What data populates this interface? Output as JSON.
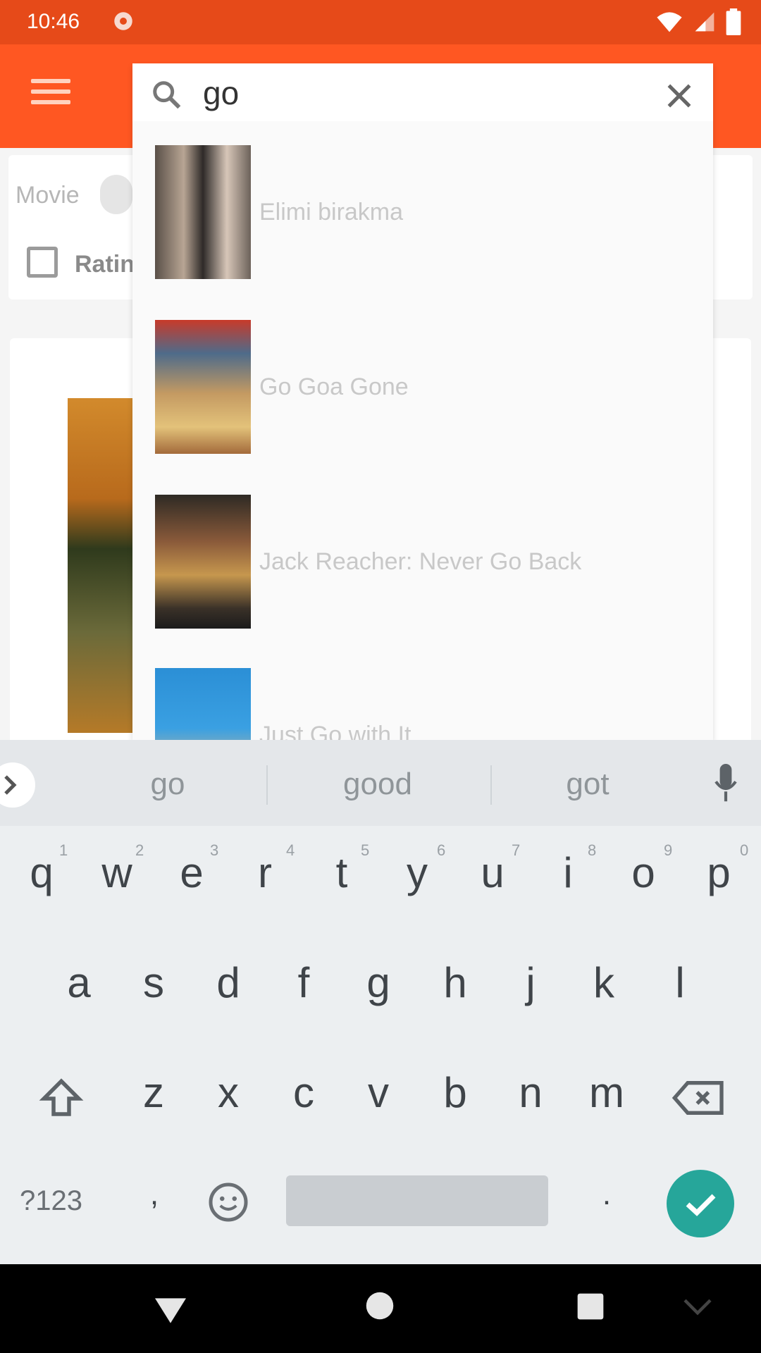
{
  "status_bar": {
    "time": "10:46"
  },
  "background": {
    "filter": {
      "movie_label": "Movie",
      "rating_label": "Ratin"
    }
  },
  "search": {
    "query": "go",
    "results": [
      {
        "title": "Elimi birakma"
      },
      {
        "title": "Go Goa Gone"
      },
      {
        "title": "Jack Reacher: Never Go Back"
      },
      {
        "title": "Just Go with It"
      }
    ]
  },
  "keyboard": {
    "suggestions": [
      "go",
      "good",
      "got"
    ],
    "row1": [
      {
        "k": "q",
        "h": "1"
      },
      {
        "k": "w",
        "h": "2"
      },
      {
        "k": "e",
        "h": "3"
      },
      {
        "k": "r",
        "h": "4"
      },
      {
        "k": "t",
        "h": "5"
      },
      {
        "k": "y",
        "h": "6"
      },
      {
        "k": "u",
        "h": "7"
      },
      {
        "k": "i",
        "h": "8"
      },
      {
        "k": "o",
        "h": "9"
      },
      {
        "k": "p",
        "h": "0"
      }
    ],
    "row2": [
      "a",
      "s",
      "d",
      "f",
      "g",
      "h",
      "j",
      "k",
      "l"
    ],
    "row3": [
      "z",
      "x",
      "c",
      "v",
      "b",
      "n",
      "m"
    ],
    "symbols_label": "?123",
    "comma": ",",
    "period": "."
  },
  "icons": {
    "status": [
      "settings-icon",
      "wifi-icon",
      "signal-icon",
      "battery-icon"
    ],
    "toolbar": [
      "menu-icon",
      "search-icon",
      "close-icon"
    ],
    "keyboard": [
      "chevron-right-icon",
      "mic-icon",
      "shift-icon",
      "backspace-icon",
      "emoji-icon",
      "check-icon"
    ],
    "nav": [
      "back-icon",
      "home-icon",
      "recents-icon",
      "keyboard-hide-icon"
    ]
  },
  "colors": {
    "status_bar": "#e64a19",
    "toolbar": "#ff5722",
    "keyboard_bg": "#eceff1",
    "enter_key": "#26a69a"
  }
}
